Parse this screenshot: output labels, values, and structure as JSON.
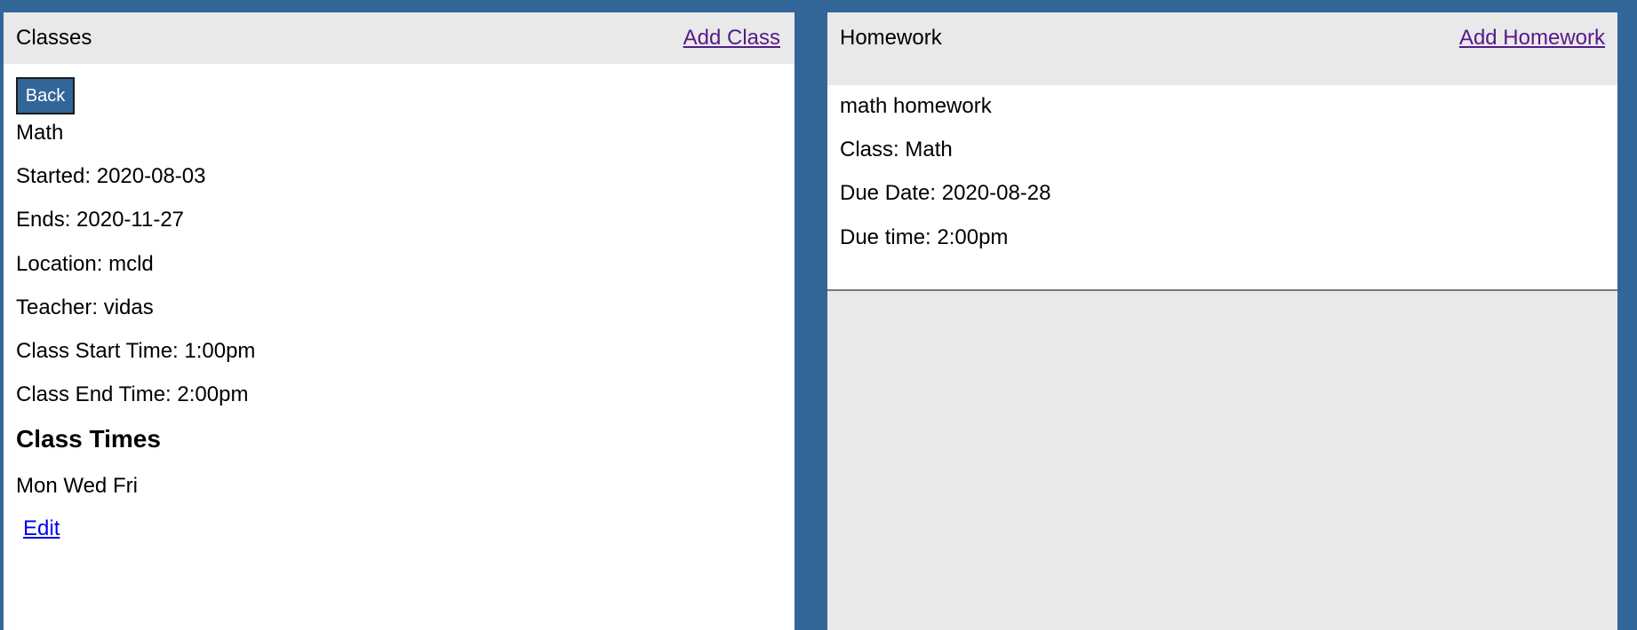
{
  "classes_panel": {
    "title": "Classes",
    "add_link": "Add Class",
    "back_label": "Back",
    "class_name": "Math",
    "details": [
      "Started: 2020-08-03",
      "Ends: 2020-11-27",
      "Location: mcld",
      "Teacher: vidas",
      "Class Start Time: 1:00pm",
      "Class End Time: 2:00pm"
    ],
    "times_heading": "Class Times",
    "days": "Mon Wed Fri",
    "edit_link": "Edit"
  },
  "homework_panel": {
    "title": "Homework",
    "add_link": "Add Homework",
    "items": [
      {
        "name": "math homework",
        "class_line": "Class: Math",
        "due_date_line": "Due Date: 2020-08-28",
        "due_time_line": "Due time: 2:00pm"
      }
    ]
  },
  "colors": {
    "background": "#326699",
    "header": "#e9e9e9",
    "link_visited": "#551a8b",
    "link": "#0000ee"
  }
}
